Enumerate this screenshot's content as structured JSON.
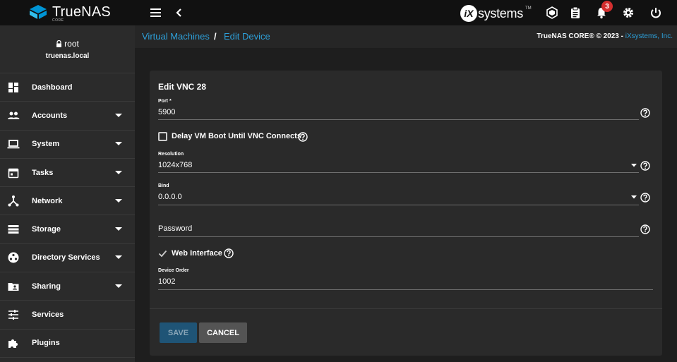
{
  "app": {
    "brand_name": "TrueNAS",
    "brand_sub": "CORE",
    "ix_letter": "iX",
    "ix_name": "systems",
    "ix_tm": "TM",
    "notification_count": "3"
  },
  "colors": {
    "accent": "#2d9fd8",
    "topbar": "#111111",
    "sidebar": "#2b2b2b",
    "card": "#2a2a2a",
    "badge": "#d32f2f"
  },
  "user": {
    "name": "root",
    "host": "truenas.local"
  },
  "sidebar": {
    "items": [
      {
        "label": "Dashboard",
        "icon": "dashboard-icon",
        "expandable": false
      },
      {
        "label": "Accounts",
        "icon": "people-icon",
        "expandable": true
      },
      {
        "label": "System",
        "icon": "laptop-icon",
        "expandable": true
      },
      {
        "label": "Tasks",
        "icon": "calendar-icon",
        "expandable": true
      },
      {
        "label": "Network",
        "icon": "network-icon",
        "expandable": true
      },
      {
        "label": "Storage",
        "icon": "storage-icon",
        "expandable": true
      },
      {
        "label": "Directory Services",
        "icon": "directory-icon",
        "expandable": true
      },
      {
        "label": "Sharing",
        "icon": "folder-shared-icon",
        "expandable": true
      },
      {
        "label": "Services",
        "icon": "tune-icon",
        "expandable": false
      },
      {
        "label": "Plugins",
        "icon": "puzzle-icon",
        "expandable": false
      }
    ]
  },
  "breadcrumb": {
    "parent": "Virtual Machines",
    "separator": "/",
    "current": "Edit Device"
  },
  "copyright": {
    "text": "TrueNAS CORE® © 2023 - ",
    "link": "iXsystems, Inc."
  },
  "form": {
    "title": "Edit VNC 28",
    "port": {
      "label": "Port *",
      "value": "5900"
    },
    "delay_boot": {
      "label": "Delay VM Boot Until VNC Connects",
      "checked": false
    },
    "resolution": {
      "label": "Resolution",
      "value": "1024x768"
    },
    "bind": {
      "label": "Bind",
      "value": "0.0.0.0"
    },
    "password": {
      "placeholder": "Password",
      "value": ""
    },
    "web_interface": {
      "label": "Web Interface",
      "checked": true
    },
    "device_order": {
      "label": "Device Order",
      "value": "1002"
    },
    "save_label": "SAVE",
    "cancel_label": "CANCEL"
  }
}
